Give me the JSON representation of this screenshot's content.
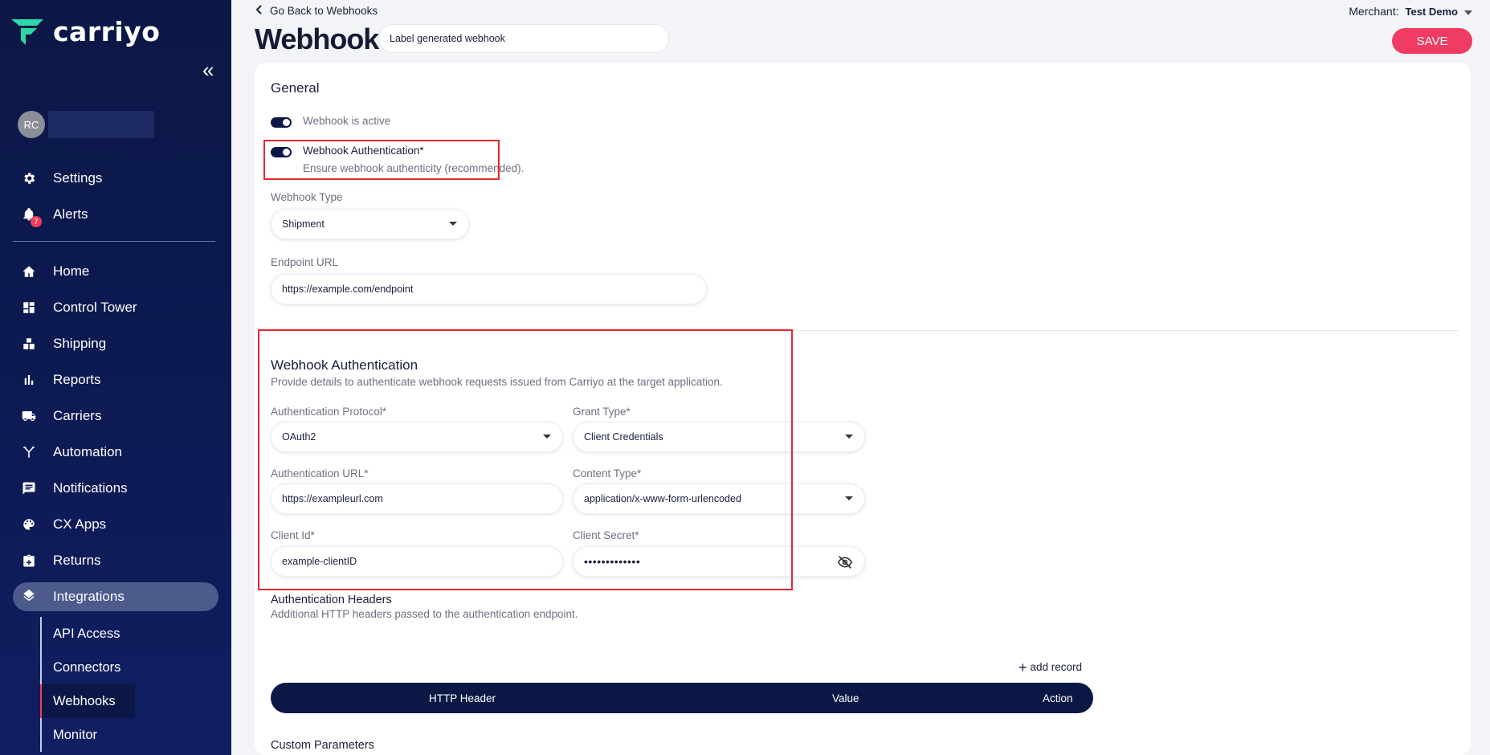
{
  "brand": {
    "name": "carriyo",
    "accent": "#2fd6a8",
    "primary": "#0b1846",
    "cta": "#f03b63"
  },
  "user": {
    "initials": "RC"
  },
  "nav_top": [
    {
      "label": "Settings",
      "icon": "gear-icon"
    },
    {
      "label": "Alerts",
      "icon": "bell-icon",
      "badge": "7"
    }
  ],
  "nav_main": [
    {
      "label": "Home",
      "icon": "home-icon"
    },
    {
      "label": "Control Tower",
      "icon": "dashboard-icon"
    },
    {
      "label": "Shipping",
      "icon": "boxes-icon"
    },
    {
      "label": "Reports",
      "icon": "bar-chart-icon"
    },
    {
      "label": "Carriers",
      "icon": "truck-icon"
    },
    {
      "label": "Automation",
      "icon": "fork-icon"
    },
    {
      "label": "Notifications",
      "icon": "message-icon"
    },
    {
      "label": "CX Apps",
      "icon": "palette-icon"
    },
    {
      "label": "Returns",
      "icon": "return-box-icon"
    },
    {
      "label": "Integrations",
      "icon": "layers-icon",
      "active": true
    }
  ],
  "nav_sub": [
    {
      "label": "API Access"
    },
    {
      "label": "Connectors"
    },
    {
      "label": "Webhooks",
      "active": true
    },
    {
      "label": "Monitor"
    }
  ],
  "header": {
    "back_label": "Go Back to Webhooks",
    "title": "Webhook",
    "label_value": "Label generated webhook",
    "merchant_label": "Merchant:",
    "merchant_value": "Test Demo",
    "save_label": "SAVE"
  },
  "general": {
    "heading": "General",
    "active_label": "Webhook is active",
    "auth_label": "Webhook Authentication*",
    "auth_sub": "Ensure webhook authenticity (recommended).",
    "type_label": "Webhook Type",
    "type_value": "Shipment",
    "endpoint_label": "Endpoint URL",
    "endpoint_value": "https://example.com/endpoint"
  },
  "auth": {
    "heading": "Webhook Authentication",
    "description": "Provide details to authenticate webhook requests issued from Carriyo at the target application.",
    "protocol_label": "Authentication Protocol*",
    "protocol_value": "OAuth2",
    "grant_label": "Grant Type*",
    "grant_value": "Client Credentials",
    "url_label": "Authentication URL*",
    "url_value": "https://exampleurl.com",
    "content_label": "Content Type*",
    "content_value": "application/x-www-form-urlencoded",
    "client_id_label": "Client Id*",
    "client_id_value": "example-clientID",
    "secret_label": "Client Secret*",
    "secret_value": "•••••••••••••"
  },
  "headers": {
    "heading": "Authentication Headers",
    "description": "Additional HTTP headers passed to the authentication endpoint.",
    "add_label": "add record",
    "columns": [
      "HTTP Header",
      "Value",
      "Action"
    ]
  },
  "custom": {
    "heading": "Custom Parameters"
  }
}
